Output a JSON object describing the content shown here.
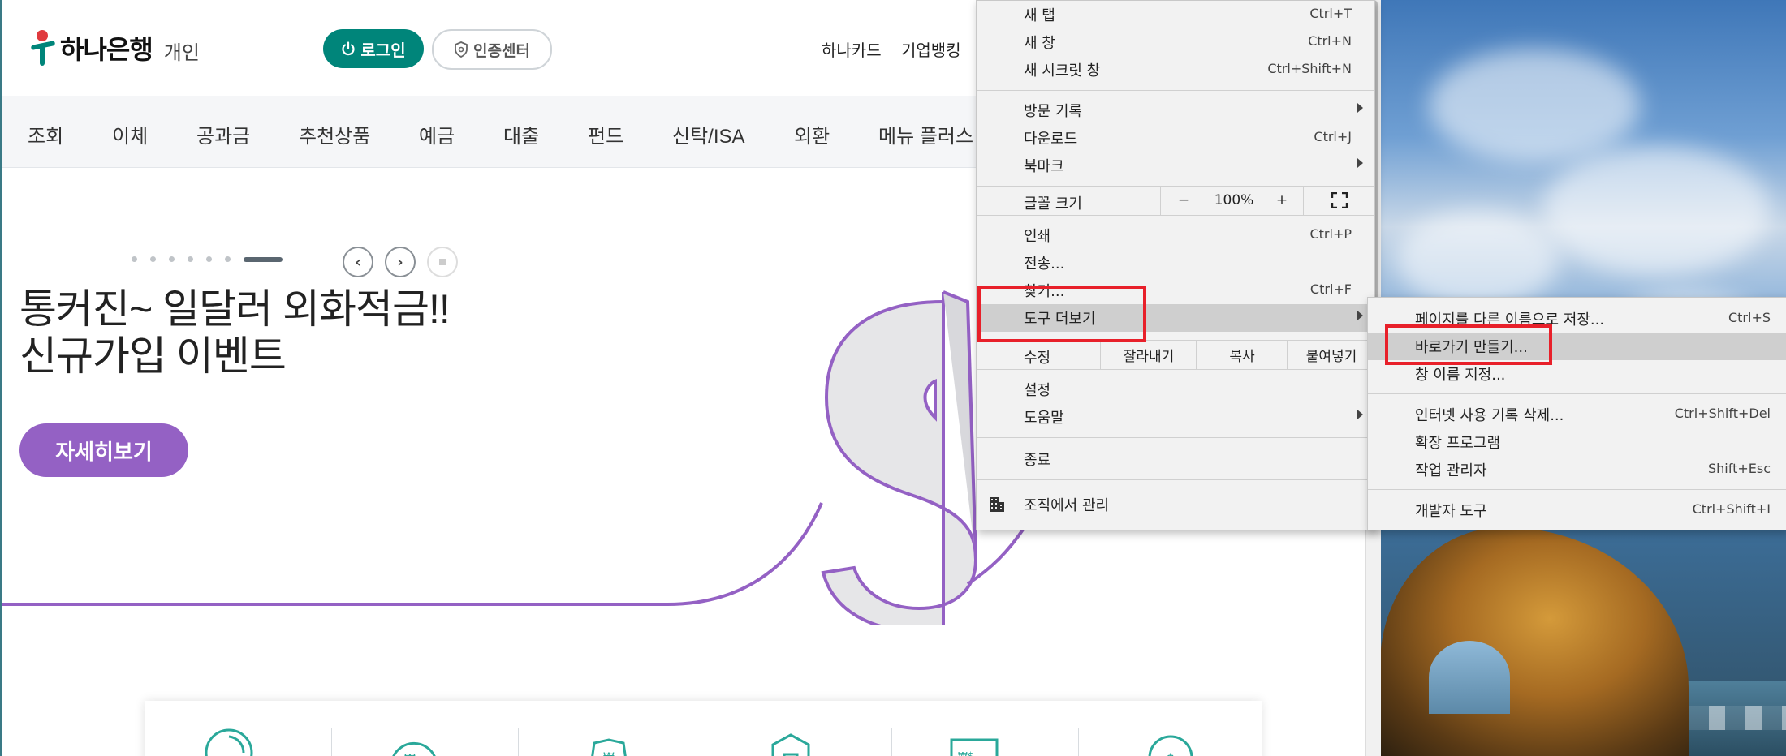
{
  "header": {
    "logo_name": "하나은행",
    "logo_sub": "개인",
    "login_label": "로그인",
    "cert_label": "인증센터",
    "links": [
      "하나카드",
      "기업뱅킹"
    ]
  },
  "nav": {
    "items": [
      "조회",
      "이체",
      "공과금",
      "추천상품",
      "예금",
      "대출",
      "펀드",
      "신탁/ISA",
      "외환",
      "메뉴 플러스"
    ]
  },
  "hero": {
    "title_line1": "통커진~ 일달러 외화적금!!",
    "title_line2": "신규가입 이벤트",
    "cta_label": "자세히보기"
  },
  "context_menu": {
    "new_tab": {
      "label": "새 탭",
      "shortcut": "Ctrl+T"
    },
    "new_window": {
      "label": "새 창",
      "shortcut": "Ctrl+N"
    },
    "new_incognito": {
      "label": "새 시크릿 창",
      "shortcut": "Ctrl+Shift+N"
    },
    "history": {
      "label": "방문 기록"
    },
    "downloads": {
      "label": "다운로드",
      "shortcut": "Ctrl+J"
    },
    "bookmarks": {
      "label": "북마크"
    },
    "zoom": {
      "label": "글꼴 크기",
      "minus": "−",
      "value": "100%",
      "plus": "+"
    },
    "print": {
      "label": "인쇄",
      "shortcut": "Ctrl+P"
    },
    "cast": {
      "label": "전송..."
    },
    "find": {
      "label": "찾기...",
      "shortcut": "Ctrl+F"
    },
    "more_tools": {
      "label": "도구 더보기"
    },
    "edit": {
      "label": "수정",
      "cut": "잘라내기",
      "copy": "복사",
      "paste": "붙여넣기"
    },
    "settings": {
      "label": "설정"
    },
    "help": {
      "label": "도움말"
    },
    "exit": {
      "label": "종료"
    },
    "managed": {
      "label": "조직에서 관리"
    }
  },
  "submenu": {
    "save_as": {
      "label": "페이지를 다른 이름으로 저장...",
      "shortcut": "Ctrl+S"
    },
    "create_shortcut": {
      "label": "바로가기 만들기..."
    },
    "name_window": {
      "label": "창 이름 지정..."
    },
    "clear_data": {
      "label": "인터넷 사용 기록 삭제...",
      "shortcut": "Ctrl+Shift+Del"
    },
    "extensions": {
      "label": "확장 프로그램"
    },
    "task_manager": {
      "label": "작업 관리자",
      "shortcut": "Shift+Esc"
    },
    "dev_tools": {
      "label": "개발자 도구",
      "shortcut": "Ctrl+Shift+I"
    }
  },
  "colors": {
    "brand": "#00857a",
    "accent_purple": "#9461c4",
    "highlight_box": "#e8202a"
  }
}
